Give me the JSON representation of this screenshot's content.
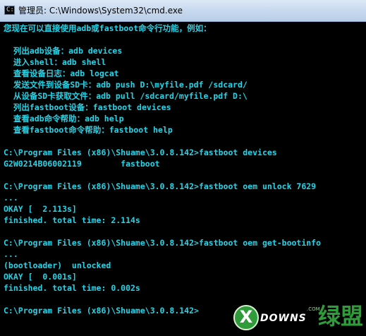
{
  "window": {
    "title": "管理员: C:\\Windows\\System32\\cmd.exe",
    "icon_text": "C:\\"
  },
  "colors": {
    "console_background": "#000000",
    "console_text": "#26d3e6",
    "titlebar": "#c6d8ee"
  },
  "console": {
    "lines": [
      "您现在可以直接使用adb或fastboot命令行功能，例如：",
      "",
      "  列出adb设备：adb devices",
      "  进入shell：adb shell",
      "  查看设备日志：adb logcat",
      "  发送文件到设备SD卡：adb push D:\\myfile.pdf /sdcard/",
      "  从设备SD卡获取文件：adb pull /sdcard/myfile.pdf D:\\",
      "  列出fastboot设备：fastboot devices",
      "  查看adb命令帮助：adb help",
      "  查看fastboot命令帮助：fastboot help",
      "",
      "C:\\Program Files (x86)\\Shuame\\3.0.8.142>fastboot devices",
      "G2W0214B06002119        fastboot",
      "",
      "C:\\Program Files (x86)\\Shuame\\3.0.8.142>fastboot oem unlock 7629",
      "...",
      "OKAY [  2.113s]",
      "finished. total time: 2.114s",
      "",
      "C:\\Program Files (x86)\\Shuame\\3.0.8.142>fastboot oem get-bootinfo",
      "...",
      "(bootloader)  unlocked",
      "OKAY [  0.001s]",
      "finished. total time: 0.002s",
      "",
      "C:\\Program Files (x86)\\Shuame\\3.0.8.142>"
    ]
  },
  "watermark": {
    "brand_mark": "X",
    "word": "DOWNS",
    "suffix": ".COM",
    "chinese": "绿盟"
  }
}
